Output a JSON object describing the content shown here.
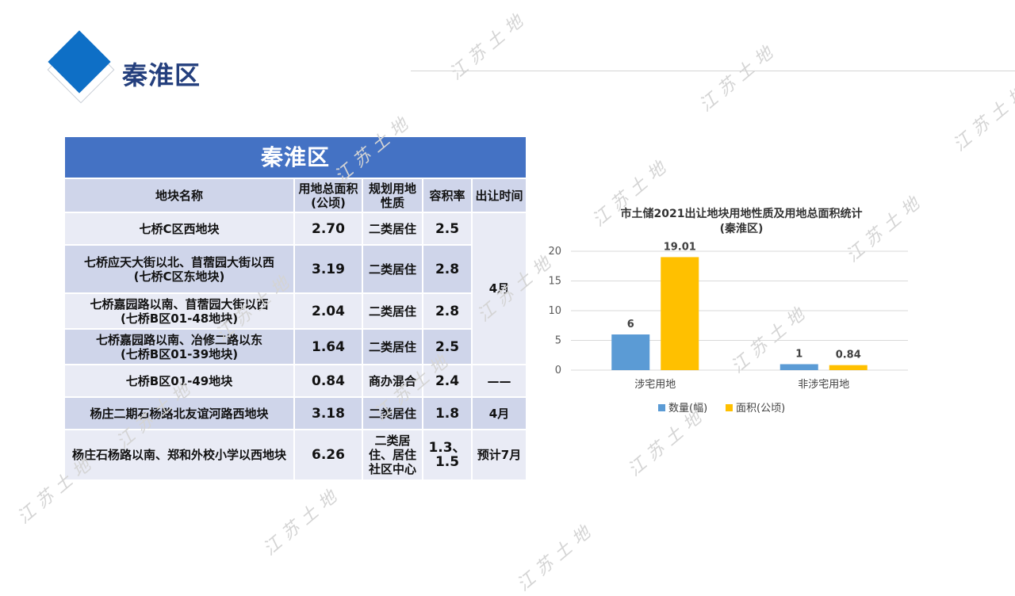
{
  "page": {
    "title": "秦淮区"
  },
  "watermark_text": "江苏土地",
  "table": {
    "banner": "秦淮区",
    "headers": [
      "地块名称",
      "用地总面积(公顷)",
      "规划用地性质",
      "容积率",
      "出让时间"
    ],
    "rows": [
      {
        "name": "七桥C区西地块",
        "area": "2.70",
        "use": "二类居住",
        "far": "2.5"
      },
      {
        "name": "七桥应天大街以北、苜蓿园大街以西\n(七桥C区东地块)",
        "area": "3.19",
        "use": "二类居住",
        "far": "2.8"
      },
      {
        "name": "七桥嘉园路以南、苜蓿园大街以西\n(七桥B区01-48地块)",
        "area": "2.04",
        "use": "二类居住",
        "far": "2.8"
      },
      {
        "name": "七桥嘉园路以南、冶修二路以东\n(七桥B区01-39地块)",
        "area": "1.64",
        "use": "二类居住",
        "far": "2.5"
      },
      {
        "name": "七桥B区01-49地块",
        "area": "0.84",
        "use": "商办混合",
        "far": "2.4",
        "time": "——"
      },
      {
        "name": "杨庄二期石杨路北友谊河路西地块",
        "area": "3.18",
        "use": "二类居住",
        "far": "1.8",
        "time": "4月"
      },
      {
        "name": "杨庄石杨路以南、郑和外校小学以西地块",
        "area": "6.26",
        "use": "二类居住、居住社区中心",
        "far": "1.3、\n1.5",
        "time": "预计7月"
      }
    ],
    "merged_time": "4月"
  },
  "chart_data": {
    "type": "bar",
    "title": "市土储2021出让地块用地性质及用地总面积统计",
    "subtitle": "(秦淮区)",
    "categories": [
      "涉宅用地",
      "非涉宅用地"
    ],
    "series": [
      {
        "name": "数量(幅)",
        "values": [
          6,
          1
        ],
        "labels": [
          "6",
          "1"
        ],
        "color": "#5b9bd5"
      },
      {
        "name": "面积(公顷)",
        "values": [
          19.01,
          0.84
        ],
        "labels": [
          "19.01",
          "0.84"
        ],
        "color": "#ffc000"
      }
    ],
    "ylim": [
      0,
      20
    ],
    "yticks": [
      0,
      5,
      10,
      15,
      20
    ],
    "grid": true,
    "legend_position": "bottom"
  }
}
